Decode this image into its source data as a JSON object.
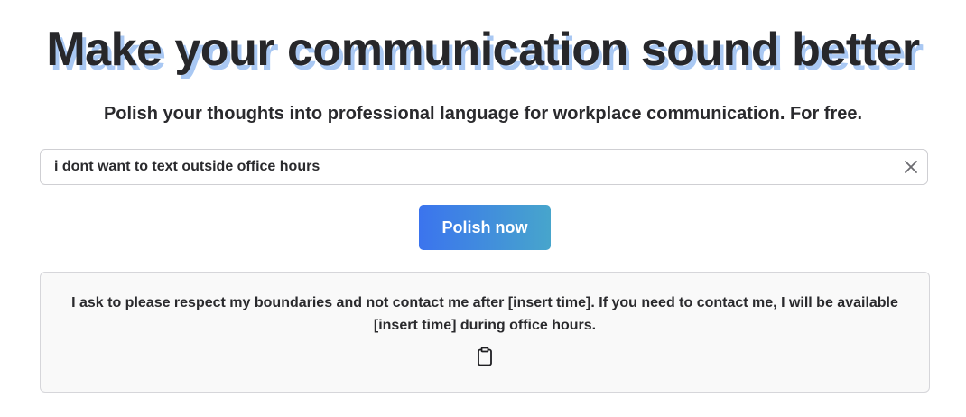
{
  "header": {
    "title": "Make your communication sound better",
    "subtitle": "Polish your thoughts into professional language for workplace communication. For free."
  },
  "input": {
    "value": "i dont want to text outside office hours",
    "clear_icon": "close-icon"
  },
  "actions": {
    "polish_label": "Polish now"
  },
  "result": {
    "text": "I ask to please respect my boundaries and not contact me after [insert time]. If you need to contact me, I will be available [insert time] during office hours.",
    "copy_icon": "clipboard-icon"
  },
  "colors": {
    "title_shadow": "#a9c8f3",
    "button_gradient_start": "#3b74ee",
    "button_gradient_end": "#47a5cc",
    "result_background": "#f9f9f9"
  }
}
